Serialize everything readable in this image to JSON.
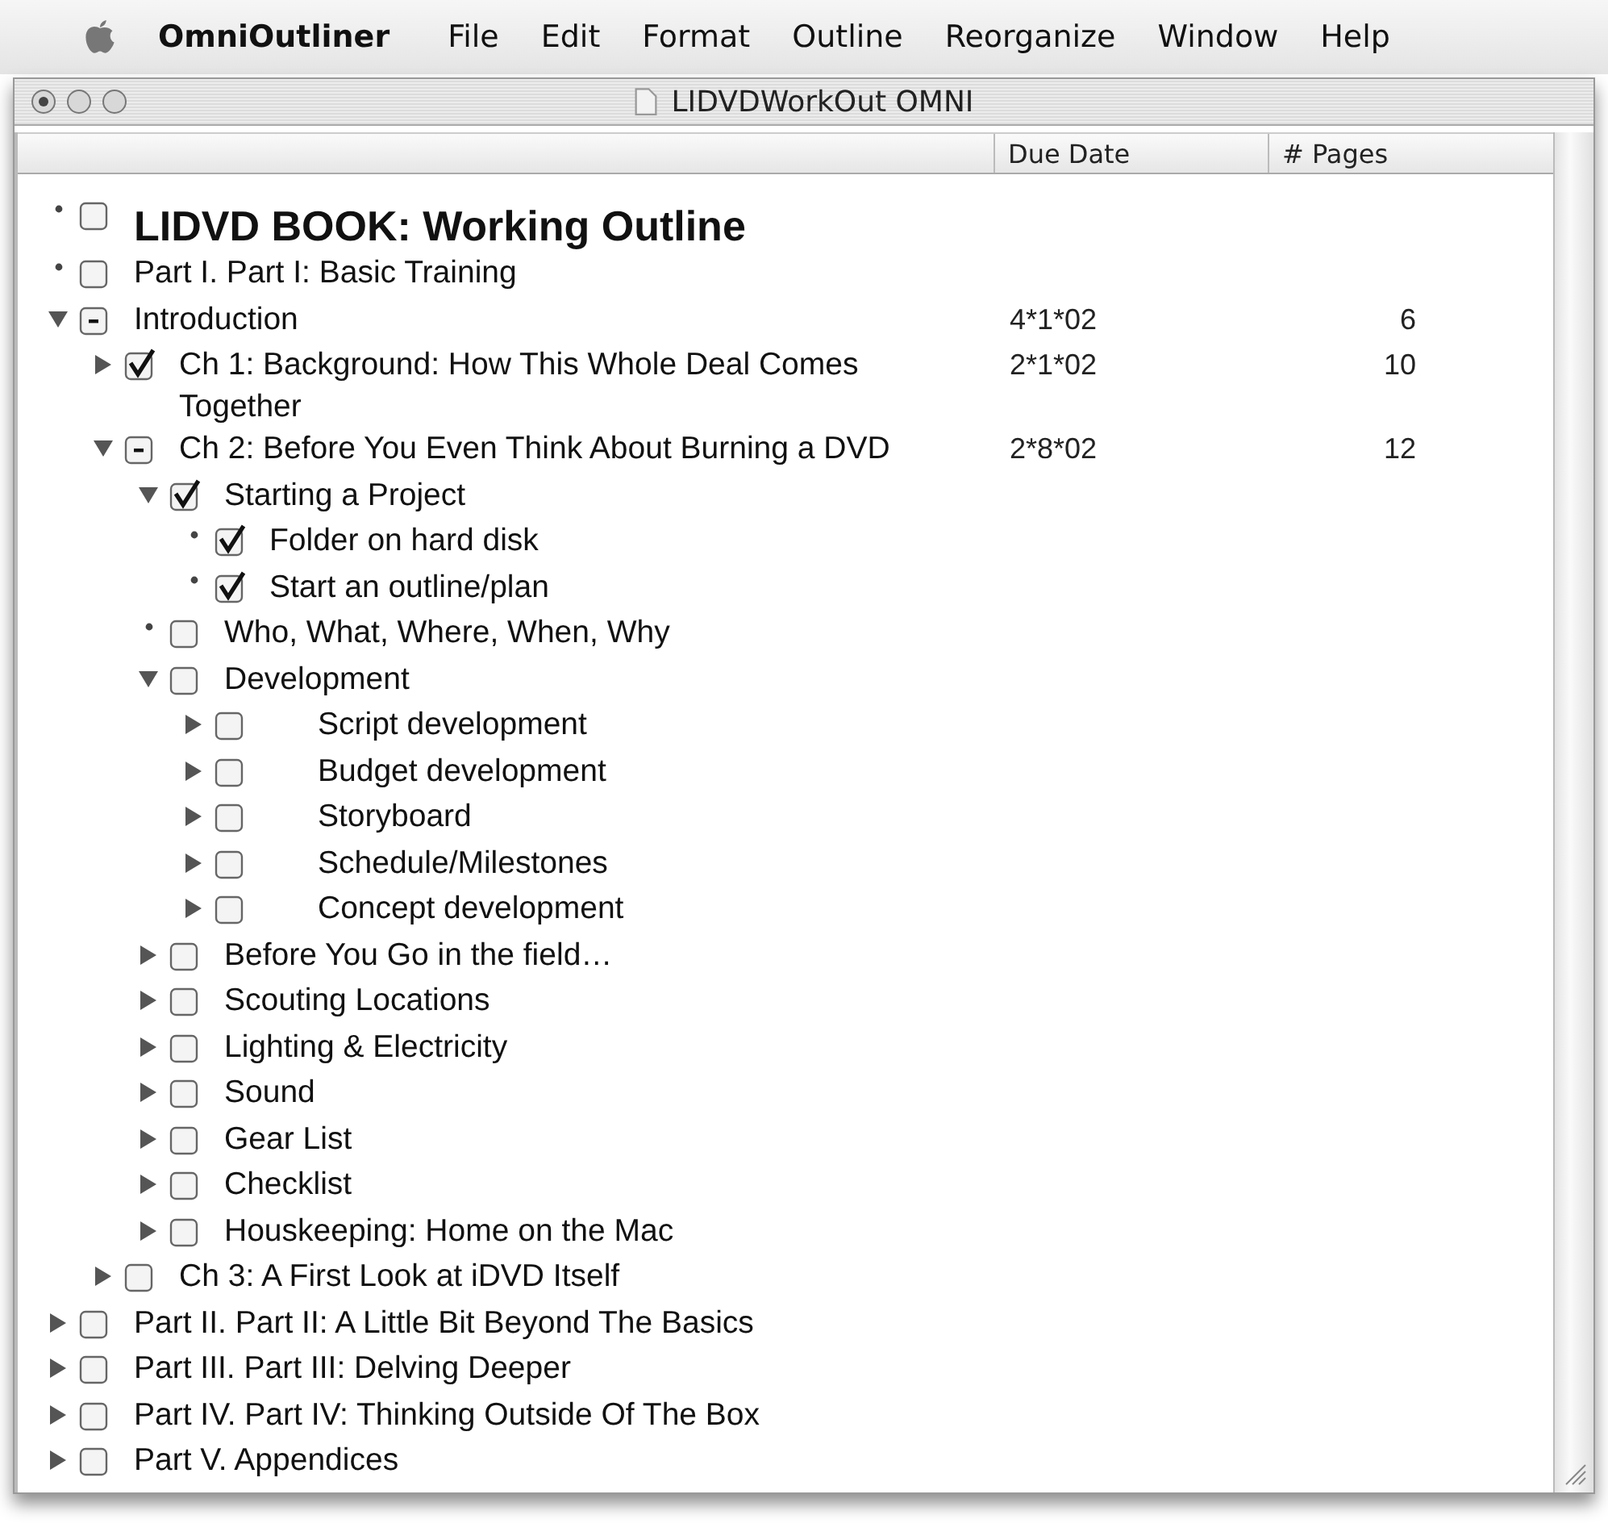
{
  "menu_bar": {
    "app_name": "OmniOutliner",
    "items": [
      "File",
      "Edit",
      "Format",
      "Outline",
      "Reorganize",
      "Window",
      "Help"
    ]
  },
  "window": {
    "title": "LIDVDWorkOut OMNI"
  },
  "columns": [
    "Due Date",
    "# Pages"
  ],
  "rows": [
    {
      "kind": "heading",
      "text": "LIDVD BOOK: Working Outline",
      "checked": false,
      "mixed": false
    },
    {
      "kind": "leaf",
      "text": "Part I. Part I: Basic Training",
      "checked": false,
      "mixed": false
    },
    {
      "kind": "branch",
      "text": "Introduction",
      "expanded": true,
      "checked": false,
      "mixed": true,
      "due_date": "4*1*02",
      "pages": "6",
      "children": [
        {
          "kind": "branch",
          "text": "Ch 1: Background: How This Whole Deal Comes Together",
          "expanded": false,
          "checked": true,
          "mixed": false,
          "due_date": "2*1*02",
          "pages": "10"
        },
        {
          "kind": "branch",
          "text": "Ch 2: Before You Even Think About Burning a DVD",
          "expanded": true,
          "checked": false,
          "mixed": true,
          "due_date": "2*8*02",
          "pages": "12",
          "children": [
            {
              "kind": "branch",
              "text": "Starting a Project",
              "expanded": true,
              "checked": true,
              "mixed": false,
              "children": [
                {
                  "kind": "leaf",
                  "text": "Folder on hard disk",
                  "checked": true,
                  "mixed": false
                },
                {
                  "kind": "leaf",
                  "text": "Start an outline/plan",
                  "checked": true,
                  "mixed": false
                }
              ]
            },
            {
              "kind": "leaf",
              "text": "Who, What, Where, When, Why",
              "checked": false,
              "mixed": false
            },
            {
              "kind": "branch",
              "text": "Development",
              "expanded": true,
              "checked": false,
              "mixed": false,
              "children": [
                {
                  "kind": "tabbed",
                  "text": "Script development",
                  "expanded": false,
                  "checked": false,
                  "mixed": false
                },
                {
                  "kind": "tabbed",
                  "text": "Budget development",
                  "expanded": false,
                  "checked": false,
                  "mixed": false
                },
                {
                  "kind": "tabbed",
                  "text": "Storyboard",
                  "expanded": false,
                  "checked": false,
                  "mixed": false
                },
                {
                  "kind": "tabbed",
                  "text": "Schedule/Milestones",
                  "expanded": false,
                  "checked": false,
                  "mixed": false
                },
                {
                  "kind": "tabbed",
                  "text": "Concept development",
                  "expanded": false,
                  "checked": false,
                  "mixed": false
                }
              ]
            },
            {
              "kind": "branch",
              "text": "Before You Go in the field…",
              "expanded": false,
              "checked": false,
              "mixed": false
            },
            {
              "kind": "branch",
              "text": "Scouting Locations",
              "expanded": false,
              "checked": false,
              "mixed": false
            },
            {
              "kind": "branch",
              "text": "Lighting & Electricity",
              "expanded": false,
              "checked": false,
              "mixed": false
            },
            {
              "kind": "branch",
              "text": "Sound",
              "expanded": false,
              "checked": false,
              "mixed": false
            },
            {
              "kind": "branch",
              "text": "Gear List",
              "expanded": false,
              "checked": false,
              "mixed": false
            },
            {
              "kind": "branch",
              "text": "Checklist",
              "expanded": false,
              "checked": false,
              "mixed": false
            },
            {
              "kind": "branch",
              "text": "Houskeeping: Home on the Mac",
              "expanded": false,
              "checked": false,
              "mixed": false
            }
          ]
        },
        {
          "kind": "branch",
          "text": "Ch 3: A First Look at iDVD Itself",
          "expanded": false,
          "checked": false,
          "mixed": false
        }
      ]
    },
    {
      "kind": "branch",
      "text": "Part II. Part II: A Little Bit Beyond The Basics",
      "expanded": false,
      "checked": false,
      "mixed": false
    },
    {
      "kind": "branch",
      "text": "Part III. Part III: Delving Deeper",
      "expanded": false,
      "checked": false,
      "mixed": false
    },
    {
      "kind": "branch",
      "text": "Part IV. Part IV: Thinking Outside Of The Box",
      "expanded": false,
      "checked": false,
      "mixed": false
    },
    {
      "kind": "branch",
      "text": "Part V. Appendices",
      "expanded": false,
      "checked": false,
      "mixed": false
    }
  ]
}
